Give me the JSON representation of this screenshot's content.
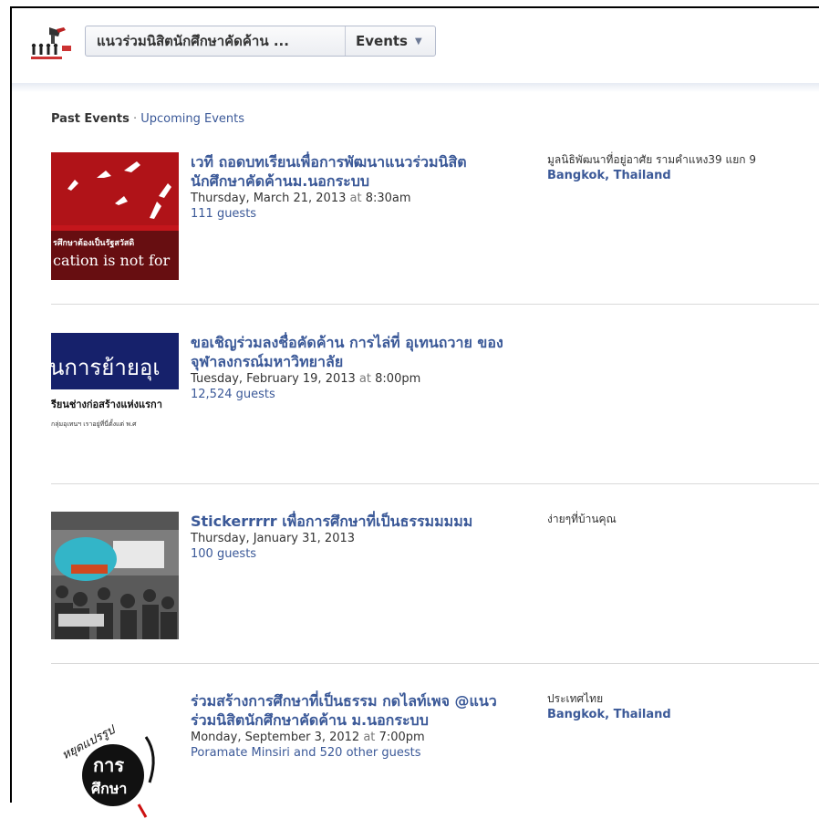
{
  "header": {
    "page_name": "แนวร่วมนิสิตนักศึกษาคัดค้าน ...",
    "section_label": "Events"
  },
  "tabs": {
    "past": "Past Events",
    "separator": "·",
    "upcoming": "Upcoming Events"
  },
  "events": [
    {
      "title": "เวที ถอดบทเรียนเพื่อการพัฒนาแนวร่วมนิสิตนักศึกษาคัดค้านม.นอกระบบ",
      "date": "Thursday, March 21, 2013",
      "at": "at",
      "time": "8:30am",
      "guests": "111 guests",
      "location_name": "มูลนิธิพัฒนาที่อยู่อาศัย รามคำแหง39 แยก 9",
      "location_city": "Bangkok, Thailand",
      "thumb_text_1": "รศึกษาต้องเป็นรัฐสวัสดิ",
      "thumb_text_2": "cation is not for"
    },
    {
      "title": "ขอเชิญร่วมลงชื่อคัดค้าน การไล่ที่ อุเทนถวาย ของจุฬาลงกรณ์มหาวิทยาลัย",
      "date": "Tuesday, February 19, 2013",
      "at": "at",
      "time": "8:00pm",
      "guests": "12,524 guests",
      "location_name": "",
      "location_city": "",
      "thumb_text_1": "นการย้ายอุเ",
      "thumb_text_2": "รียนช่างก่อสร้างแห่งแรกา",
      "thumb_text_3": "กลุ่มอุเทนฯ เราอยู่ที่นี่ตั้งแต่ พ.ศ"
    },
    {
      "title": "Stickerrrrr เพื่อการศึกษาที่เป็นธรรมมมมม",
      "date": "Thursday, January 31, 2013",
      "at": "",
      "time": "",
      "guests": "100 guests",
      "location_name": "ง่ายๆที่บ้านคุณ",
      "location_city": ""
    },
    {
      "title": "ร่วมสร้างการศึกษาที่เป็นธรรม กดไลท์เพจ @แนวร่วมนิสิตนักศึกษาคัดค้าน ม.นอกระบบ",
      "date": "Monday, September 3, 2012",
      "at": "at",
      "time": "7:00pm",
      "guests": "Poramate Minsiri and 520 other guests",
      "location_name": "ประเทศไทย",
      "location_city": "Bangkok, Thailand",
      "thumb_text_1": "หยุดแปรรูป",
      "thumb_text_2": "การ",
      "thumb_text_3": "ศึกษา"
    }
  ],
  "colors": {
    "link": "#3b5998",
    "text": "#333333",
    "muted": "#777777"
  }
}
